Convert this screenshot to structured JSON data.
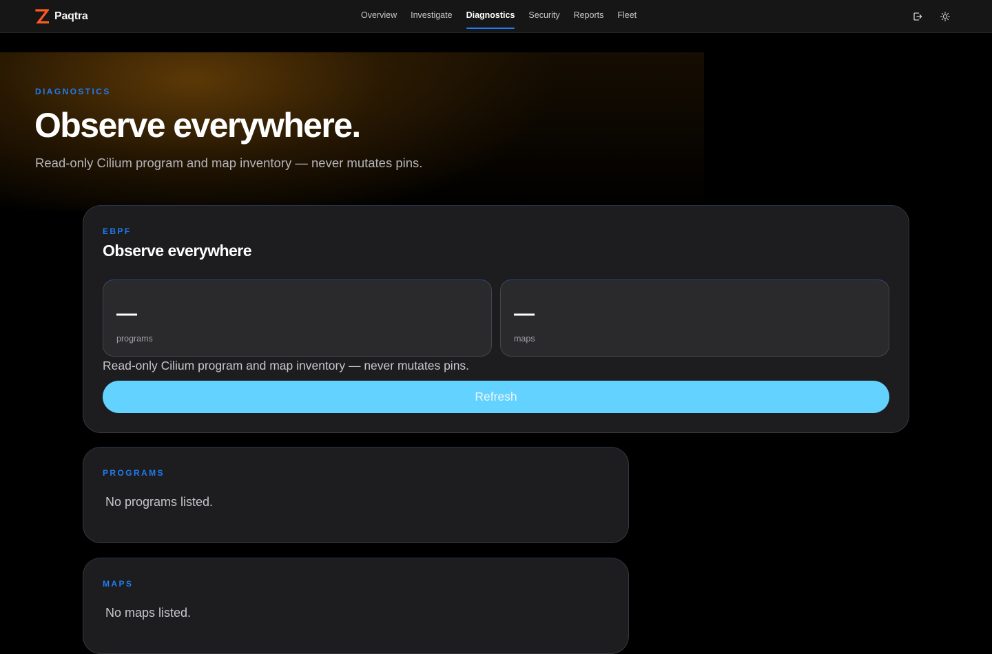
{
  "app": {
    "brand_name": "Paqtra",
    "logo_icon": "z-logo-icon",
    "accent_color": "#1f7cf2",
    "brand_color": "#ff5a1f"
  },
  "nav": {
    "items": [
      {
        "label": "Overview",
        "active": false
      },
      {
        "label": "Investigate",
        "active": false
      },
      {
        "label": "Diagnostics",
        "active": true
      },
      {
        "label": "Security",
        "active": false
      },
      {
        "label": "Reports",
        "active": false
      },
      {
        "label": "Fleet",
        "active": false
      }
    ],
    "actions": [
      {
        "icon": "sign-out-icon"
      },
      {
        "icon": "sun-icon"
      }
    ]
  },
  "hero": {
    "eyebrow": "DIAGNOSTICS",
    "title": "Observe everywhere.",
    "subtitle": "Read-only Cilium program and map inventory — never mutates pins."
  },
  "ebpf_card": {
    "eyebrow": "EBPF",
    "title": "Observe everywhere",
    "stats": [
      {
        "value": "—",
        "label": "programs"
      },
      {
        "value": "—",
        "label": "maps"
      }
    ],
    "note": "Read-only Cilium program and map inventory — never mutates pins.",
    "refresh_label": "Refresh",
    "button_color": "#64d2ff"
  },
  "programs": {
    "eyebrow": "PROGRAMS",
    "empty_text": "No programs listed."
  },
  "maps": {
    "eyebrow": "MAPS",
    "empty_text": "No maps listed."
  }
}
